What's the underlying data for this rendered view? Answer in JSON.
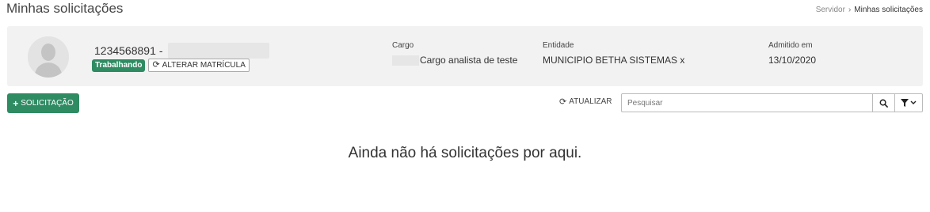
{
  "page": {
    "title": "Minhas solicitações"
  },
  "breadcrumb": {
    "parent": "Servidor",
    "separator": "›",
    "current": "Minhas solicitações"
  },
  "employee": {
    "registration": "1234568891",
    "separator": "-",
    "status_badge": "Trabalhando",
    "status_color": "#2e8b62",
    "alter_button": "ALTERAR MATRÍCULA",
    "cargo_label": "Cargo",
    "cargo_value": "Cargo analista de teste",
    "entidade_label": "Entidade",
    "entidade_value": "MUNICIPIO BETHA SISTEMAS x",
    "admitido_label": "Admitido em",
    "admitido_value": "13/10/2020"
  },
  "toolbar": {
    "add_button": "SOLICITAÇÃO",
    "add_icon": "plus-icon",
    "refresh_button": "ATUALIZAR",
    "refresh_icon": "refresh-icon",
    "search_placeholder": "Pesquisar",
    "search_icon": "search-icon",
    "filter_icon": "filter-icon"
  },
  "empty_state": {
    "message": "Ainda não há solicitações por aqui."
  },
  "colors": {
    "accent": "#2e8b62",
    "panel_bg": "#f2f2f2"
  }
}
